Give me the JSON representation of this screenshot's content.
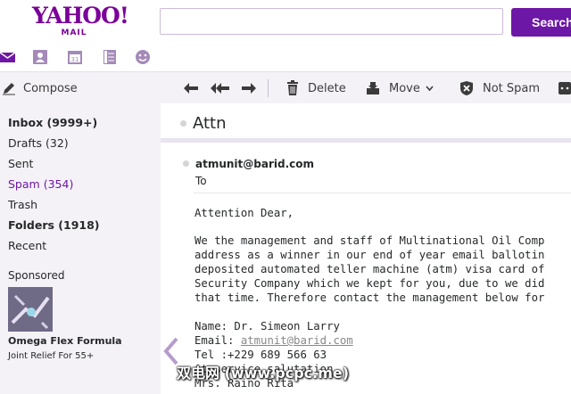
{
  "header": {
    "logo_brand": "YAHOO!",
    "logo_sub": "MAIL",
    "search_placeholder": "",
    "search_button": "Search"
  },
  "app_icons": [
    "mail-icon",
    "contacts-icon",
    "calendar-icon",
    "notepad-icon",
    "messenger-icon"
  ],
  "toolbar": {
    "compose": "Compose",
    "delete": "Delete",
    "move": "Move",
    "not_spam": "Not Spam"
  },
  "sidebar": {
    "folders": [
      {
        "label": "Inbox",
        "count": "(9999+)"
      },
      {
        "label": "Drafts",
        "count": "(32)"
      },
      {
        "label": "Sent",
        "count": ""
      },
      {
        "label": "Spam",
        "count": "(354)"
      },
      {
        "label": "Trash",
        "count": ""
      },
      {
        "label": "Folders",
        "count": "(1918)"
      },
      {
        "label": "Recent",
        "count": ""
      }
    ],
    "sponsored": "Sponsored",
    "ad_title": "Omega Flex Formula",
    "ad_subtitle": "Joint Relief For 55+"
  },
  "message": {
    "subject": "Attn",
    "from": "atmunit@barid.com",
    "to": "To",
    "greeting": "Attention Dear,",
    "body_lines": [
      "We the management and staff of Multinational Oil Comp",
      "address as a winner in our end of year email ballotin",
      "deposited automated teller machine (atm) visa card of",
      "Security Company which we kept for you, due to we did",
      "that time. Therefore contact the management below for"
    ],
    "name_line": "Name: Dr. Simeon Larry",
    "email_label": "Email: ",
    "email_value": "atmunit@barid.com",
    "tel_line": "Tel :+229 689 566 63",
    "service_line": "At service salutation,",
    "sign_line": "Mrs. Raino Rita"
  },
  "watermark": "双电网 (www.pcpc.me)",
  "colors": {
    "brand_purple": "#6d17a6",
    "logo_purple": "#7b0099",
    "sidebar_bg": "#f4f2f7"
  }
}
